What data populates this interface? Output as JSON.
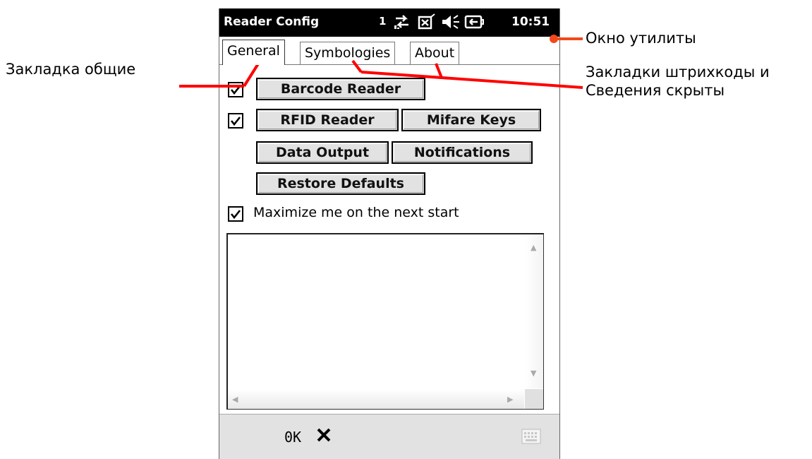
{
  "titlebar": {
    "title": "Reader Config",
    "signal_indicator": "1",
    "clock": "10:51",
    "icons": [
      "connectivity-icon",
      "notification-icon",
      "volume-icon",
      "battery-charging-icon"
    ]
  },
  "tabs": [
    {
      "label": "General",
      "active": true
    },
    {
      "label": "Symbologies",
      "active": false
    },
    {
      "label": "About",
      "active": false
    }
  ],
  "rows": {
    "barcode_label": "Barcode Reader",
    "rfid_label": "RFID Reader",
    "mifare_label": "Mifare Keys",
    "data_output_label": "Data Output",
    "notifications_label": "Notifications",
    "restore_label": "Restore Defaults",
    "barcode_checked": true,
    "rfid_checked": true
  },
  "maximize": {
    "label": "Maximize me on the next start",
    "checked": true
  },
  "bottombar": {
    "ok_label": "0K",
    "close_icon": "close-icon",
    "keyboard_icon": "keyboard-icon"
  },
  "annotations": {
    "general_tab": "Закладка общие",
    "utility_window": "Окно утилиты",
    "hidden_tabs_line1": "Закладки штрихкоды и",
    "hidden_tabs_line2": "Сведения скрыты"
  },
  "colors": {
    "annotation_line": "#ff0000",
    "annotation_dot": "#f04a1a",
    "titlebar": "#000000",
    "button_face": "#e2e2e2"
  }
}
